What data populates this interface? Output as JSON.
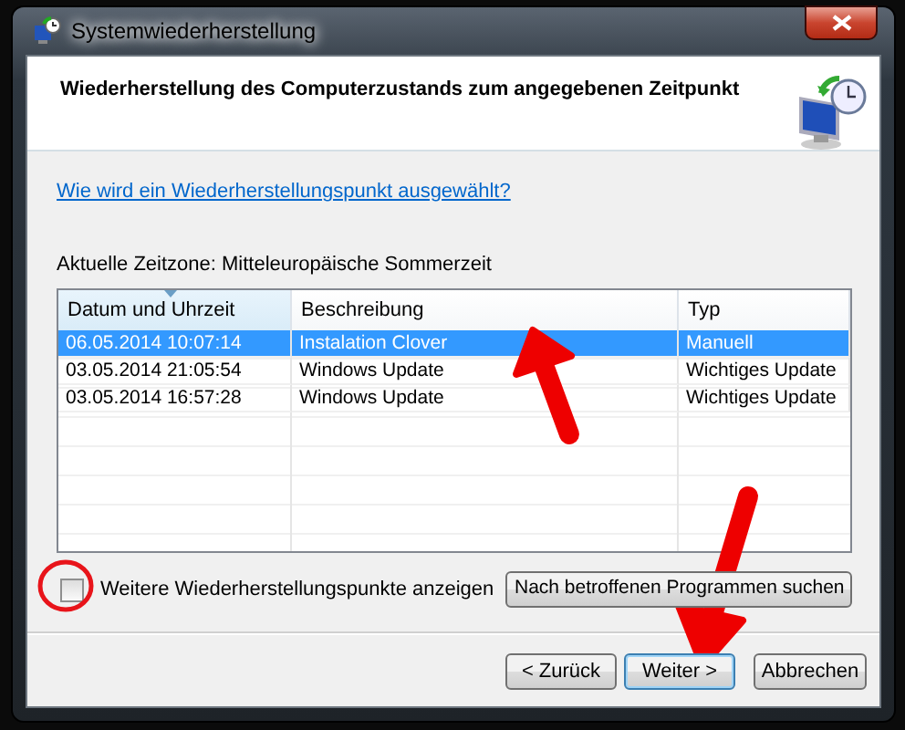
{
  "window": {
    "title": "Systemwiederherstellung"
  },
  "header": {
    "title": "Wiederherstellung des Computerzustands zum angegebenen Zeitpunkt"
  },
  "help_link": "Wie wird ein Wiederherstellungspunkt ausgewählt?",
  "timezone": "Aktuelle Zeitzone: Mitteleuropäische Sommerzeit",
  "table": {
    "columns": [
      {
        "label": "Datum und Uhrzeit",
        "sorted": true
      },
      {
        "label": "Beschreibung",
        "sorted": false
      },
      {
        "label": "Typ",
        "sorted": false
      }
    ],
    "rows": [
      {
        "date": "06.05.2014 10:07:14",
        "description": "Instalation Clover",
        "type": "Manuell",
        "selected": true
      },
      {
        "date": "03.05.2014 21:05:54",
        "description": "Windows Update",
        "type": "Wichtiges Update",
        "selected": false
      },
      {
        "date": "03.05.2014 16:57:28",
        "description": "Windows Update",
        "type": "Wichtiges Update",
        "selected": false
      }
    ]
  },
  "show_more": {
    "label": "Weitere Wiederherstellungspunkte anzeigen",
    "checked": false
  },
  "scan_button": "Nach betroffenen Programmen suchen",
  "buttons": [
    {
      "label": "< Zurück",
      "default": false
    },
    {
      "label": "Weiter >",
      "default": true
    },
    {
      "label": "Abbrechen",
      "default": false
    }
  ]
}
